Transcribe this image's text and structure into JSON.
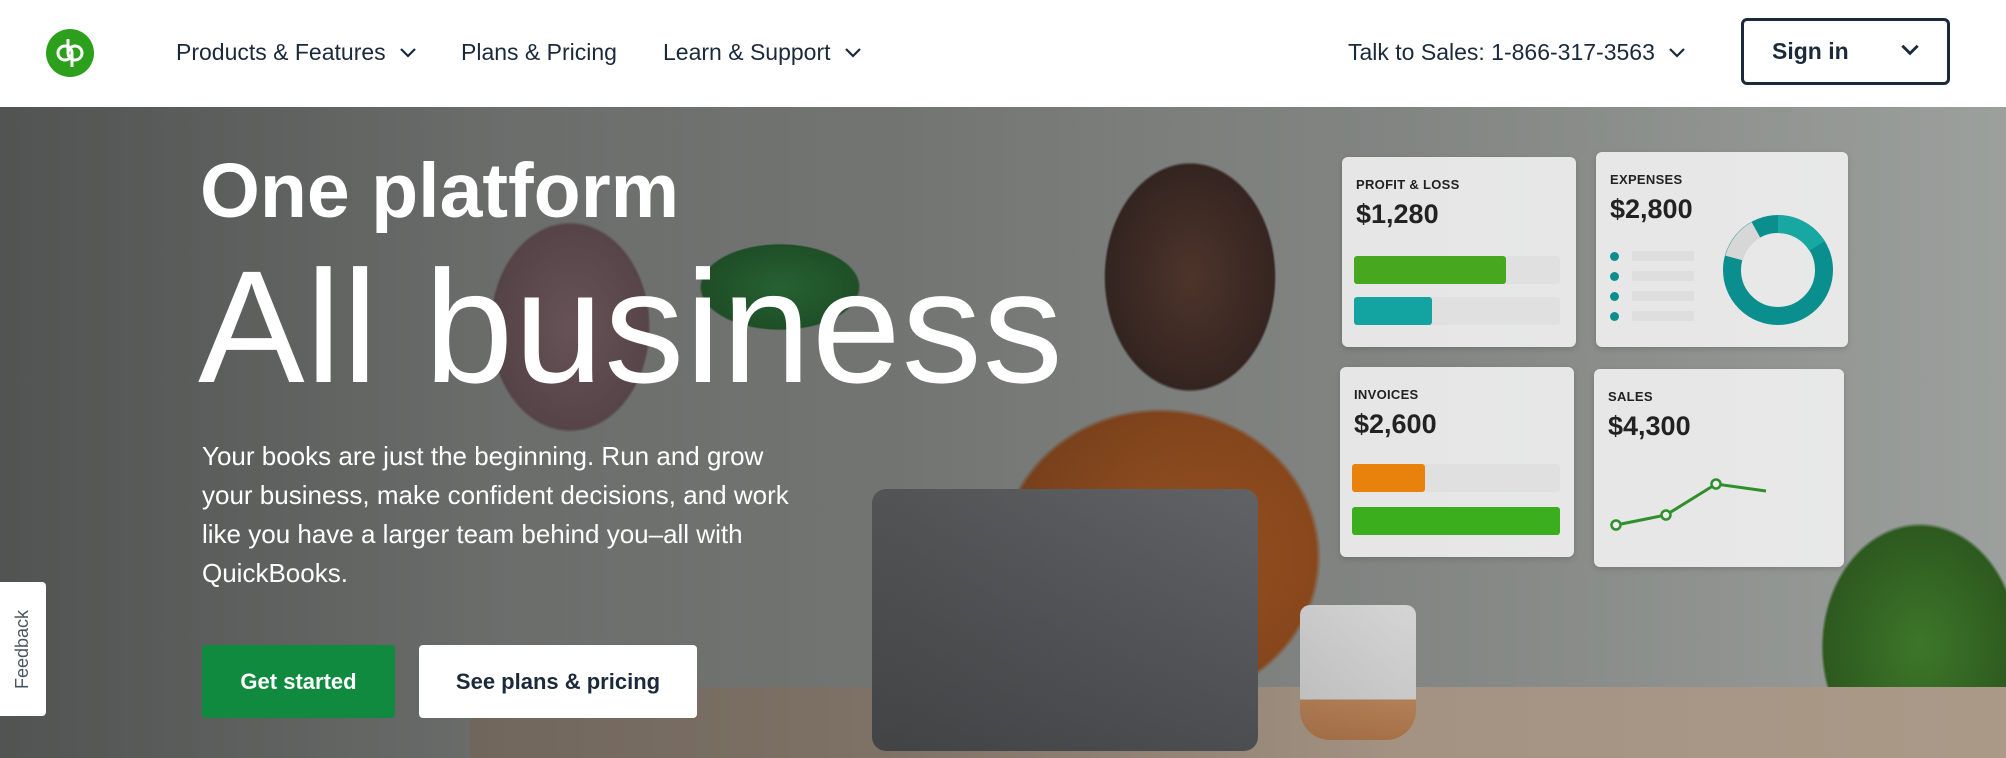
{
  "header": {
    "logo_text": "qb",
    "nav": [
      {
        "label": "Products & Features",
        "has_dropdown": true
      },
      {
        "label": "Plans & Pricing",
        "has_dropdown": false
      },
      {
        "label": "Learn & Support",
        "has_dropdown": true
      }
    ],
    "sales": {
      "label": "Talk to Sales: 1-866-317-3563",
      "has_dropdown": true
    },
    "signin_label": "Sign in"
  },
  "hero": {
    "subtitle": "One platform",
    "title": "All business",
    "description": "Your books are just the beginning. Run and grow your business, make confident decisions, and work like you have a larger team behind you–all with QuickBooks.",
    "primary_button": "Get started",
    "secondary_button": "See plans & pricing"
  },
  "feedback_label": "Feedback",
  "dashboard": {
    "profit_loss": {
      "label": "PROFIT & LOSS",
      "value": "$1,280",
      "bars": [
        {
          "fill": 0.74,
          "color": "#47a81f"
        },
        {
          "fill": 0.38,
          "color": "#13a3a0"
        }
      ]
    },
    "expenses": {
      "label": "EXPENSES",
      "value": "$2,800"
    },
    "invoices": {
      "label": "INVOICES",
      "value": "$2,600",
      "bars": [
        {
          "fill": 0.35,
          "color": "#e8820c"
        },
        {
          "fill": 1.0,
          "color": "#3aae1c"
        }
      ]
    },
    "sales": {
      "label": "SALES",
      "value": "$4,300"
    }
  },
  "colors": {
    "brand_green": "#2ca01c",
    "button_green": "#108a3e",
    "text_dark": "#1b2a3a",
    "teal": "#0b8e8e"
  }
}
